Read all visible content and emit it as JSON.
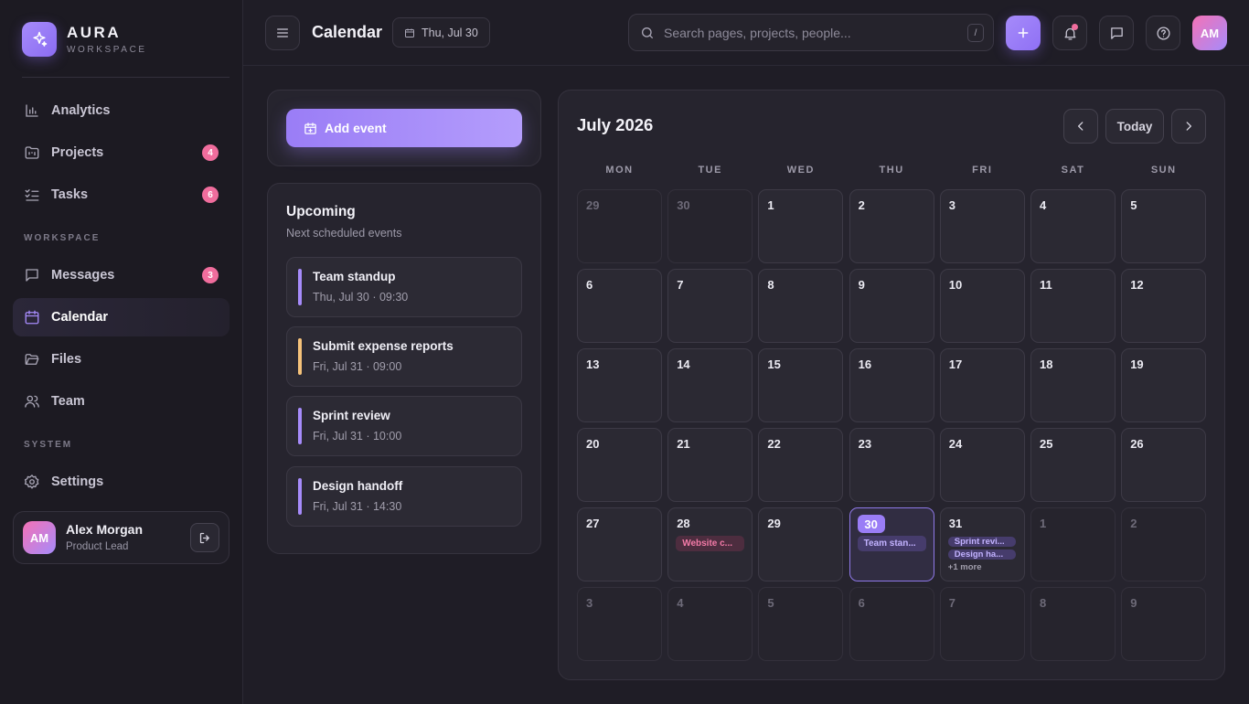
{
  "brand": {
    "name": "AURA",
    "subtitle": "WORKSPACE"
  },
  "sidebar": {
    "items": [
      {
        "label": "Analytics"
      },
      {
        "label": "Projects",
        "badge": "4"
      },
      {
        "label": "Tasks",
        "badge": "6"
      },
      {
        "label": "Messages",
        "badge": "3"
      },
      {
        "label": "Calendar"
      },
      {
        "label": "Files"
      },
      {
        "label": "Team"
      },
      {
        "label": "Settings"
      }
    ],
    "sections": {
      "workspace": "WORKSPACE",
      "system": "SYSTEM"
    },
    "active": "Calendar"
  },
  "user": {
    "initials": "AM",
    "name": "Alex Morgan",
    "role": "Product Lead"
  },
  "topbar": {
    "title": "Calendar",
    "date_chip": "Thu, Jul 30",
    "search_placeholder": "Search pages, projects, people...",
    "search_shortcut": "/"
  },
  "left_panel": {
    "add_event_label": "Add event",
    "upcoming_title": "Upcoming",
    "upcoming_subtitle": "Next scheduled events",
    "events": [
      {
        "title": "Team standup",
        "time": "Thu, Jul 30 · 09:30",
        "color": "#a68bfa"
      },
      {
        "title": "Submit expense reports",
        "time": "Fri, Jul 31 · 09:00",
        "color": "#f5c27a"
      },
      {
        "title": "Sprint review",
        "time": "Fri, Jul 31 · 10:00",
        "color": "#a68bfa"
      },
      {
        "title": "Design handoff",
        "time": "Fri, Jul 31 · 14:30",
        "color": "#a68bfa"
      }
    ]
  },
  "calendar": {
    "month_label": "July 2026",
    "today_label": "Today",
    "weekdays": [
      "MON",
      "TUE",
      "WED",
      "THU",
      "FRI",
      "SAT",
      "SUN"
    ],
    "days": [
      {
        "n": "29",
        "out": true
      },
      {
        "n": "30",
        "out": true
      },
      {
        "n": "1"
      },
      {
        "n": "2"
      },
      {
        "n": "3"
      },
      {
        "n": "4"
      },
      {
        "n": "5"
      },
      {
        "n": "6"
      },
      {
        "n": "7"
      },
      {
        "n": "8"
      },
      {
        "n": "9"
      },
      {
        "n": "10"
      },
      {
        "n": "11"
      },
      {
        "n": "12"
      },
      {
        "n": "13"
      },
      {
        "n": "14"
      },
      {
        "n": "15"
      },
      {
        "n": "16"
      },
      {
        "n": "17"
      },
      {
        "n": "18"
      },
      {
        "n": "19"
      },
      {
        "n": "20"
      },
      {
        "n": "21"
      },
      {
        "n": "22"
      },
      {
        "n": "23"
      },
      {
        "n": "24"
      },
      {
        "n": "25"
      },
      {
        "n": "26"
      },
      {
        "n": "27"
      },
      {
        "n": "28",
        "events": [
          {
            "label": "Website c...",
            "tone": "pink"
          }
        ]
      },
      {
        "n": "29"
      },
      {
        "n": "30",
        "today": true,
        "events": [
          {
            "label": "Team stan...",
            "tone": "purple"
          }
        ]
      },
      {
        "n": "31",
        "events": [
          {
            "label": "Sprint revi...",
            "tone": "purple"
          },
          {
            "label": "Design ha...",
            "tone": "purple"
          }
        ],
        "more": "+1 more"
      },
      {
        "n": "1",
        "out": true
      },
      {
        "n": "2",
        "out": true
      },
      {
        "n": "3",
        "out": true
      },
      {
        "n": "4",
        "out": true
      },
      {
        "n": "5",
        "out": true
      },
      {
        "n": "6",
        "out": true
      },
      {
        "n": "7",
        "out": true
      },
      {
        "n": "8",
        "out": true
      },
      {
        "n": "9",
        "out": true
      }
    ]
  },
  "colors": {
    "accent": "#9a7df6",
    "badge": "#f06d9d",
    "background": "#1f1d26"
  }
}
